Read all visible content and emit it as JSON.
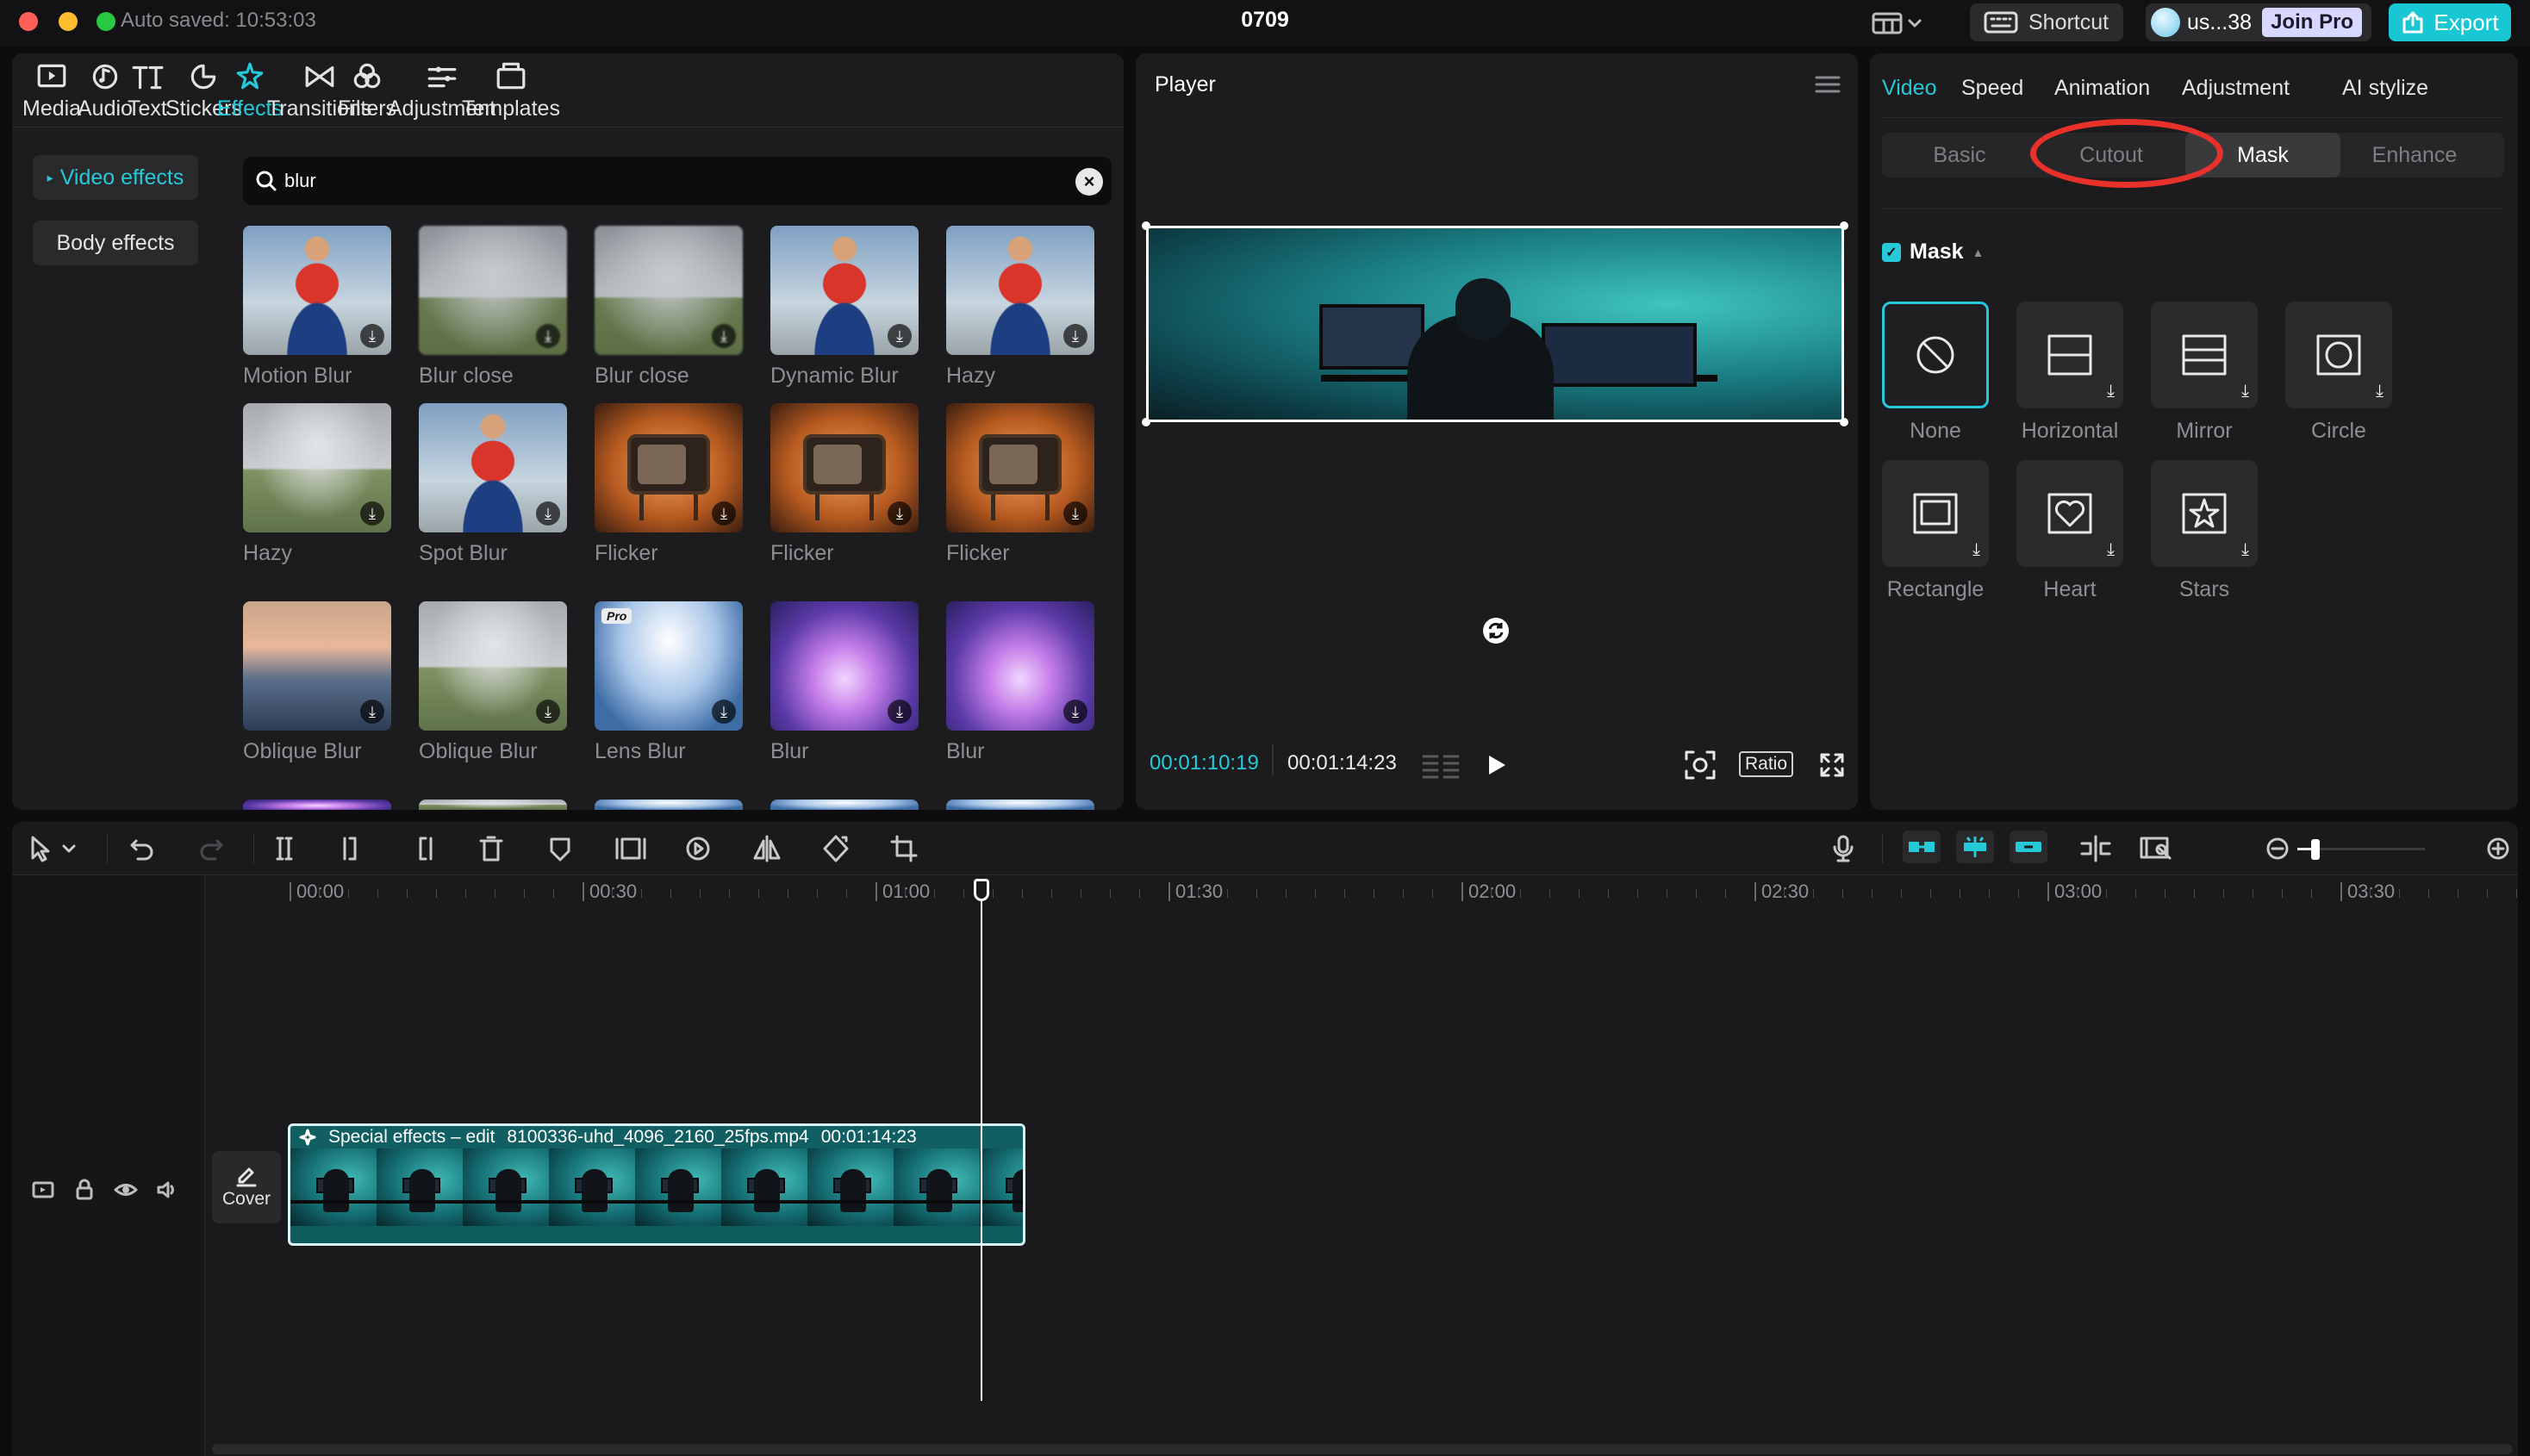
{
  "window": {
    "autosave": "Auto saved: 10:53:03",
    "title": "0709",
    "shortcut_label": "Shortcut",
    "user_label": "us...38",
    "join_pro_label": "Join Pro",
    "export_label": "Export"
  },
  "media_panel": {
    "tabs": [
      {
        "label": "Media",
        "icon": "media-icon"
      },
      {
        "label": "Audio",
        "icon": "audio-icon"
      },
      {
        "label": "Text",
        "icon": "text-icon"
      },
      {
        "label": "Stickers",
        "icon": "stickers-icon"
      },
      {
        "label": "Effects",
        "icon": "effects-icon",
        "active": true
      },
      {
        "label": "Transitions",
        "icon": "transitions-icon"
      },
      {
        "label": "Filters",
        "icon": "filters-icon"
      },
      {
        "label": "Adjustment",
        "icon": "adjustment-icon"
      },
      {
        "label": "Templates",
        "icon": "templates-icon"
      }
    ],
    "categories": [
      "Video effects",
      "Body effects"
    ],
    "search": {
      "value": "blur"
    },
    "effects": [
      {
        "label": "Motion Blur",
        "thumb": "person"
      },
      {
        "label": "Blur close",
        "thumb": "blurry"
      },
      {
        "label": "Blur close",
        "thumb": "blurry"
      },
      {
        "label": "Dynamic Blur",
        "thumb": "person"
      },
      {
        "label": "Hazy",
        "thumb": "person"
      },
      {
        "label": "Hazy",
        "thumb": "meadow"
      },
      {
        "label": "Spot Blur",
        "thumb": "person"
      },
      {
        "label": "Flicker",
        "thumb": "tv"
      },
      {
        "label": "Flicker",
        "thumb": "tv"
      },
      {
        "label": "Flicker",
        "thumb": "tv"
      },
      {
        "label": "Oblique Blur",
        "thumb": "city"
      },
      {
        "label": "Oblique Blur",
        "thumb": "meadow"
      },
      {
        "label": "Lens Blur",
        "thumb": "lens",
        "badge": "Pro"
      },
      {
        "label": "Blur",
        "thumb": "purple"
      },
      {
        "label": "Blur",
        "thumb": "purple"
      }
    ]
  },
  "player": {
    "title": "Player",
    "time_current": "00:01:10:19",
    "time_total": "00:01:14:23",
    "ratio_label": "Ratio"
  },
  "inspector": {
    "tabs": [
      "Video",
      "Speed",
      "Animation",
      "Adjustment",
      "AI stylize"
    ],
    "active_tab": "Video",
    "subtabs": [
      "Basic",
      "Cutout",
      "Mask",
      "Enhance"
    ],
    "active_subtab": "Mask",
    "mask_section_label": "Mask",
    "mask_enabled": true,
    "masks": [
      {
        "label": "None",
        "icon": "none-icon",
        "selected": true
      },
      {
        "label": "Horizontal",
        "icon": "horizontal-mask-icon"
      },
      {
        "label": "Mirror",
        "icon": "mirror-mask-icon"
      },
      {
        "label": "Circle",
        "icon": "circle-mask-icon"
      },
      {
        "label": "Rectangle",
        "icon": "rectangle-mask-icon"
      },
      {
        "label": "Heart",
        "icon": "heart-mask-icon"
      },
      {
        "label": "Stars",
        "icon": "star-mask-icon"
      }
    ],
    "highlight_color": "#e8312a"
  },
  "timeline": {
    "ruler": [
      "00:00",
      "00:30",
      "01:00",
      "01:30",
      "02:00",
      "02:30",
      "03:00",
      "03:30"
    ],
    "cover_label": "Cover",
    "clip": {
      "effect_label": "Special effects – edit",
      "filename": "8100336-uhd_4096_2160_25fps.mp4",
      "duration": "00:01:14:23"
    }
  },
  "colors": {
    "accent": "#25c9d8",
    "panel": "#1c1c1e",
    "background": "#0d0d0f"
  }
}
